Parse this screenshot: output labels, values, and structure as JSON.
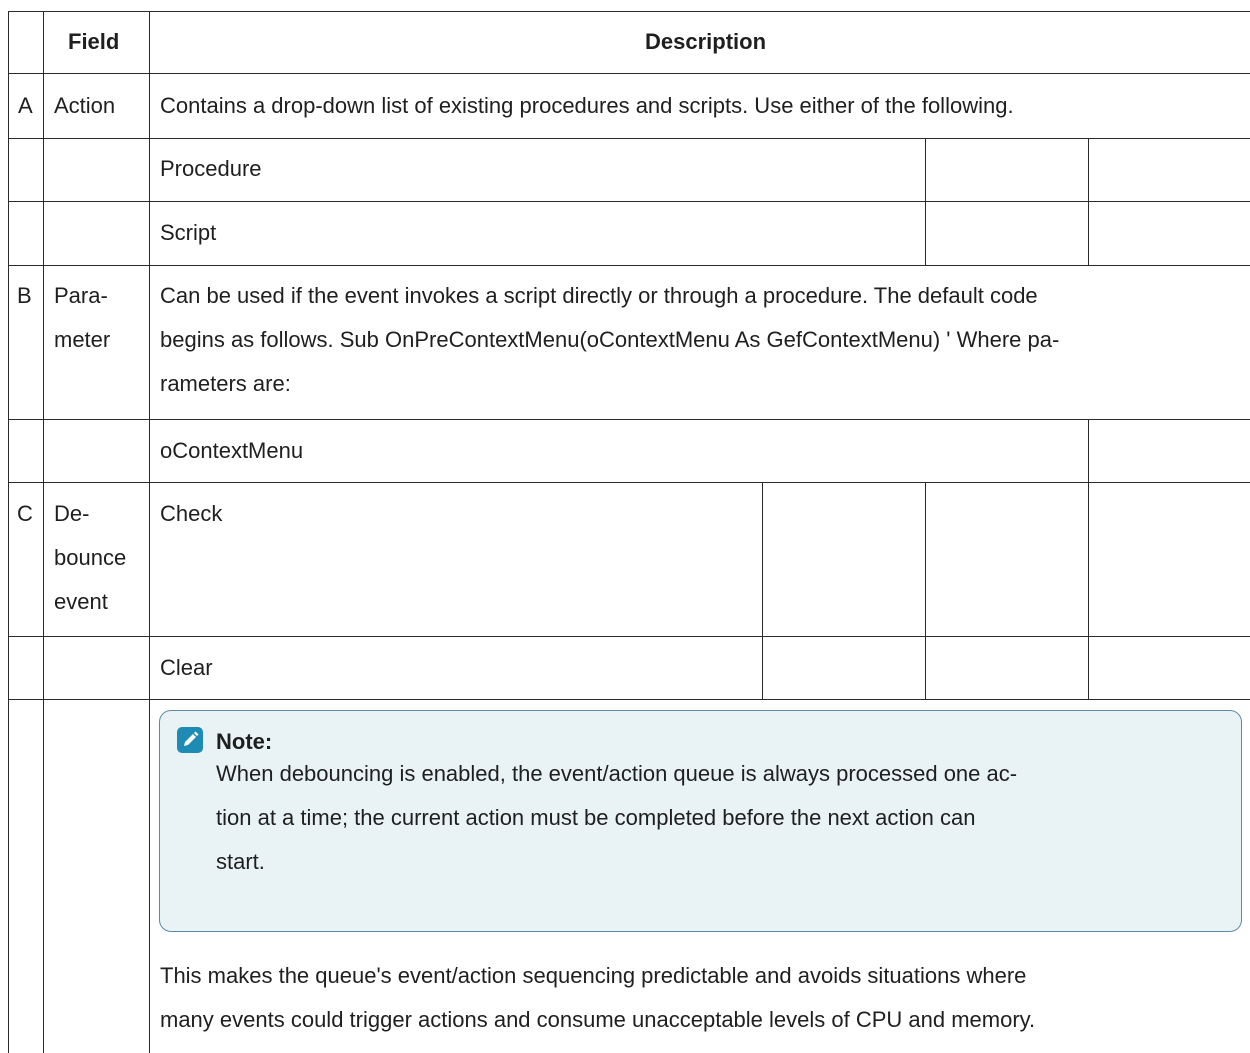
{
  "header": {
    "field": "Field",
    "description": "Description"
  },
  "rows": {
    "a": {
      "letter": "A",
      "field": "Action",
      "description": "Contains a drop-down list of existing procedures and scripts. Use either of the following."
    },
    "procedure": {
      "label": "Procedure"
    },
    "script": {
      "label": "Script"
    },
    "b": {
      "letter": "B",
      "field_line1": "Para-",
      "field_line2": "meter",
      "desc_line1": "Can be used if the event invokes a script directly or through a procedure. The default code",
      "desc_line2": "begins as follows. Sub OnPreContextMenu(oContextMenu As GefContextMenu) ' Where pa-",
      "desc_line3": "rameters are:"
    },
    "ocontextmenu": {
      "label": "oContextMenu"
    },
    "c": {
      "letter": "C",
      "field_line1": "De-",
      "field_line2": "bounce",
      "field_line3": "event",
      "check": "Check"
    },
    "clear": {
      "label": "Clear"
    }
  },
  "note": {
    "icon": "pencil-icon",
    "title": "Note:",
    "line1": "When debouncing is enabled, the event/action queue is always processed one ac-",
    "line2": "tion at a time; the current action must be completed before the next action can",
    "line3": "start."
  },
  "footer": {
    "line1": "This makes the queue's event/action sequencing predictable and avoids situations where",
    "line2": "many events could trigger actions and consume unacceptable levels of CPU and memory."
  }
}
